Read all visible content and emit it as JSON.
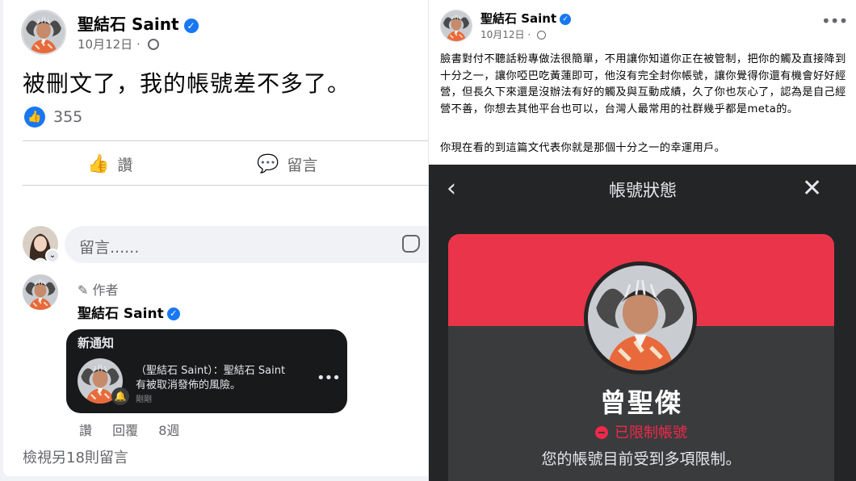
{
  "left_post": {
    "author": "聖結石 Saint",
    "date": "10月12日",
    "separator": "·",
    "text": "被刪文了，我的帳號差不多了。",
    "like_count": "355",
    "like_label": "讚",
    "comment_label": "留言",
    "comment_placeholder": "留言......",
    "comment": {
      "author_tag": "作者",
      "author": "聖結石 Saint",
      "notification": {
        "title": "新通知",
        "line1": "（聖結石 Saint）：聖結石 Saint",
        "line2": "有被取消發佈的風險。",
        "time": "剛剛"
      },
      "actions": {
        "like": "讚",
        "reply": "回覆",
        "age": "8週"
      }
    },
    "view_more": "檢視另18則留言"
  },
  "right_post": {
    "author": "聖結石 Saint",
    "date": "10月12日",
    "separator": "·",
    "body": "臉書對付不聽話粉專做法很簡單，不用讓你知道你正在被管制，把你的觸及直接降到十分之一，讓你啞巴吃黃蓮即可，他沒有完全封你帳號，讓你覺得你還有機會好好經營，但長久下來還是沒辦法有好的觸及與互動成績，久了你也灰心了，認為是自己經營不善，你想去其他平台也可以，台灣人最常用的社群幾乎都是meta的。",
    "body2": "你現在看的到這篇文代表你就是那個十分之一的幸運用戶。",
    "account_status": {
      "title": "帳號狀態",
      "name": "曾聖傑",
      "status": "已限制帳號",
      "description": "您的帳號目前受到多項限制。"
    }
  },
  "colors": {
    "facebook_blue": "#1877f2",
    "restricted_red": "#e9344a",
    "dark_bg": "#242526"
  },
  "icons": [
    "verified-badge-icon",
    "globe-icon",
    "like-reaction-icon",
    "thumbs-up-icon",
    "comment-bubble-icon",
    "sticker-icon",
    "pencil-icon",
    "bell-icon",
    "more-dots-icon",
    "back-chevron-icon",
    "close-x-icon",
    "restricted-minus-icon"
  ]
}
